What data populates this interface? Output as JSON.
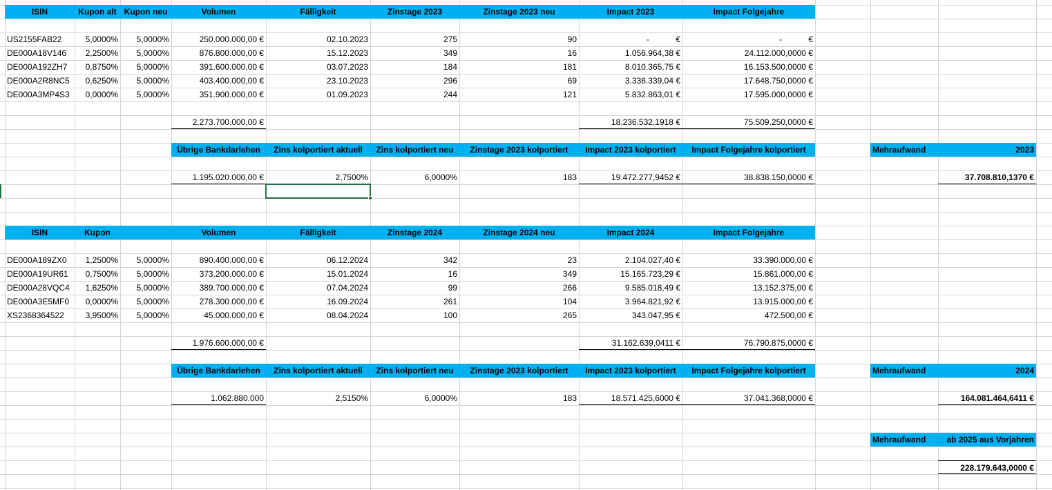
{
  "theme": {
    "header_fill": "#00b0f0",
    "gridline": "#d4d4d4",
    "selection": "#217346"
  },
  "sheet": {
    "block_2023": {
      "header": [
        "ISIN",
        "Kupon alt",
        "Kupon neu",
        "Volumen",
        "Fälligkeit",
        "Zinstage 2023",
        "Zinstage 2023 neu",
        "Impact 2023",
        "Impact Folgejahre"
      ],
      "rows": [
        [
          "US2155FAB22",
          "5,0000%",
          "5,0000%",
          "250.000.000,00 €",
          "02.10.2023",
          "275",
          "90",
          "-",
          "€",
          "-",
          "€"
        ],
        [
          "DE000A18V146",
          "2,2500%",
          "5,0000%",
          "876.800.000,00 €",
          "15.12.2023",
          "349",
          "16",
          "1.056.964,38 €",
          "",
          "24.112.000,0000 €",
          ""
        ],
        [
          "DE000A192ZH7",
          "0,8750%",
          "5,0000%",
          "391.600.000,00 €",
          "03.07.2023",
          "184",
          "181",
          "8.010.365,75 €",
          "",
          "16.153.500,0000 €",
          ""
        ],
        [
          "DE000A2R8NC5",
          "0,6250%",
          "5,0000%",
          "403.400.000,00 €",
          "23.10.2023",
          "296",
          "69",
          "3.336.339,04 €",
          "",
          "17.648.750,0000 €",
          ""
        ],
        [
          "DE000A3MP4S3",
          "0,0000%",
          "5,0000%",
          "351.900.000,00 €",
          "01.09.2023",
          "244",
          "121",
          "5.832.863,01 €",
          "",
          "17.595.000,0000 €",
          ""
        ]
      ],
      "totals": {
        "volumen": "2.273.700.000,00 €",
        "impact": "18.236.532,1918 €",
        "folgejahre": "75.509.250,0000 €"
      },
      "sub_header": [
        "Übrige Bankdarlehen",
        "Zins kolportiert aktuell",
        "Zins kolportiert neu",
        "Zinstage 2023 kolportiert",
        "Impact 2023 kolportiert",
        "Impact Folgejahre kolportiert"
      ],
      "sub_values": [
        "1.195.020.000,00 €",
        "2,7500%",
        "6,0000%",
        "183",
        "19.472.277,9452 €",
        "38.838.150,0000 €"
      ],
      "mehraufwand": {
        "label": "Mehraufwand",
        "year": "2023",
        "value": "37.708.810,1370 €"
      }
    },
    "block_2024": {
      "header": [
        "ISIN",
        "Kupon",
        "Volumen",
        "Fälligkeit",
        "Zinstage 2024",
        "Zinstage 2024 neu",
        "Impact 2024",
        "Impact Folgejahre"
      ],
      "rows": [
        [
          "DE000A189ZX0",
          "1,2500%",
          "5,0000%",
          "890.400.000,00 €",
          "06.12.2024",
          "342",
          "23",
          "2.104.027,40 €",
          "33.390.000,00 €"
        ],
        [
          "DE000A19UR61",
          "0,7500%",
          "5,0000%",
          "373.200.000,00 €",
          "15.01.2024",
          "16",
          "349",
          "15.165.723,29 €",
          "15.861.000,00 €"
        ],
        [
          "DE000A28VQC4",
          "1,6250%",
          "5,0000%",
          "389.700.000,00 €",
          "07.04.2024",
          "99",
          "266",
          "9.585.018,49 €",
          "13.152.375,00 €"
        ],
        [
          "DE000A3E5MF0",
          "0,0000%",
          "5,0000%",
          "278.300.000,00 €",
          "16.09.2024",
          "261",
          "104",
          "3.964.821,92 €",
          "13.915.000,00 €"
        ],
        [
          "XS2368364522",
          "3,9500%",
          "5,0000%",
          "45.000.000,00 €",
          "08.04.2024",
          "100",
          "265",
          "343.047,95 €",
          "472.500,00 €"
        ]
      ],
      "totals": {
        "volumen": "1.976.600.000,00 €",
        "impact": "31.162.639,0411 €",
        "folgejahre": "76.790.875,0000 €"
      },
      "sub_header": [
        "Übrige Bankdarlehen",
        "Zins kolportiert aktuell",
        "Zins kolportiert neu",
        "Zinstage 2023 kolportiert",
        "Impact 2023 kolportiert",
        "Impact Folgejahre kolportiert"
      ],
      "sub_values": [
        "1.062.880.000",
        "2,5150%",
        "6,0000%",
        "183",
        "18.571.425,6000 €",
        "37.041.368,0000 €"
      ],
      "mehraufwand": {
        "label": "Mehraufwand",
        "year": "2024",
        "value": "164.081.464,6411 €"
      }
    },
    "ab2025": {
      "label": "Mehraufwand",
      "sublabel": "ab 2025 aus Vorjahren",
      "value": "228.179.643,0000 €"
    }
  }
}
